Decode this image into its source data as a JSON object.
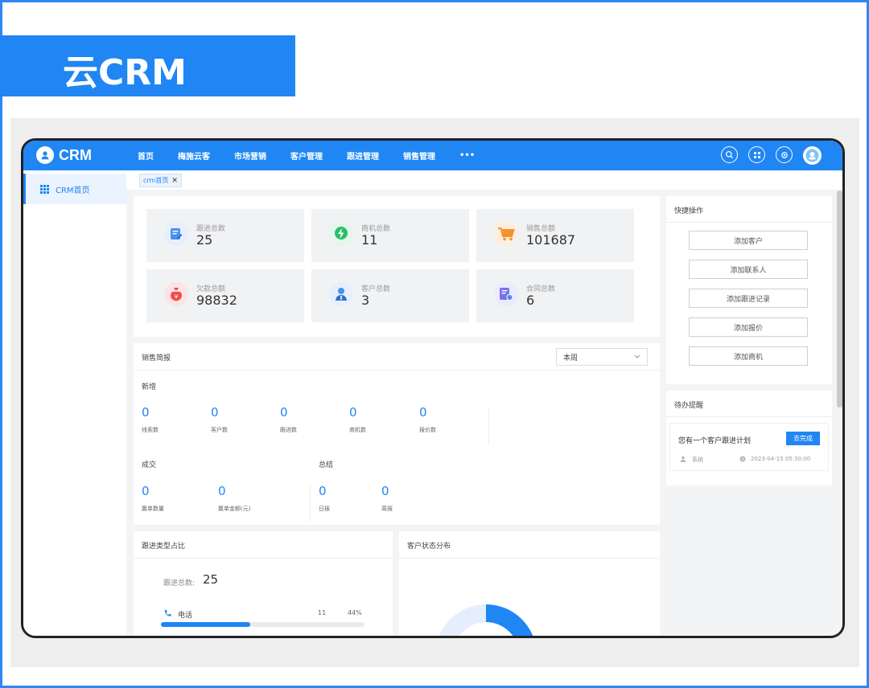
{
  "page": {
    "title": "云CRM"
  },
  "app": {
    "logo_text": "CRM",
    "nav": [
      "首页",
      "梅施云客",
      "市场营销",
      "客户管理",
      "跟进管理",
      "销售管理",
      "•••"
    ],
    "top_icons": [
      "search-icon",
      "grid-icon",
      "settings-icon",
      "user-avatar"
    ]
  },
  "sidebar": {
    "items": [
      {
        "label": "CRM首页",
        "icon": "grid-icon"
      }
    ]
  },
  "tabs": [
    {
      "label": "crm首页"
    }
  ],
  "stats": [
    {
      "label": "跟进总数",
      "value": "25",
      "icon": "edit-icon",
      "color": "#4a90f0"
    },
    {
      "label": "商机总数",
      "value": "11",
      "icon": "bolt-icon",
      "color": "#2bbf6a"
    },
    {
      "label": "销售总额",
      "value": "101687",
      "icon": "cart-icon",
      "color": "#f5922e"
    },
    {
      "label": "欠款总额",
      "value": "98832",
      "icon": "money-bag-icon",
      "color": "#ee5050"
    },
    {
      "label": "客户总数",
      "value": "3",
      "icon": "person-icon",
      "color": "#4a90f0"
    },
    {
      "label": "合同总数",
      "value": "6",
      "icon": "contract-icon",
      "color": "#7b6ff0"
    }
  ],
  "sales_report": {
    "title": "销售简报",
    "period": "本周",
    "new_label": "新增",
    "new_items": [
      {
        "value": "0",
        "label": "线索数"
      },
      {
        "value": "0",
        "label": "客户数"
      },
      {
        "value": "0",
        "label": "跟进数"
      },
      {
        "value": "0",
        "label": "商机数"
      },
      {
        "value": "0",
        "label": "报价数"
      }
    ],
    "deal_label": "成交",
    "deal_items": [
      {
        "value": "0",
        "label": "赢单数量"
      },
      {
        "value": "0",
        "label": "赢单金额(元)"
      }
    ],
    "summary_label": "总结",
    "summary_items": [
      {
        "value": "0",
        "label": "日报"
      },
      {
        "value": "0",
        "label": "周报"
      }
    ]
  },
  "quick_actions": {
    "title": "快捷操作",
    "buttons": [
      "添加客户",
      "添加联系人",
      "添加跟进记录",
      "添加报价",
      "添加商机"
    ]
  },
  "todo": {
    "title": "待办提醒",
    "item_text": "您有一个客户跟进计划",
    "done_button": "去完成",
    "source": "系统",
    "time": "2023-04-15 05:30:00"
  },
  "follow_ratio": {
    "title": "跟进类型占比",
    "total_label": "跟进总数:",
    "total_value": "25",
    "rows": [
      {
        "label": "电话",
        "count": "11",
        "percent": "44%",
        "fraction": 0.44
      }
    ]
  },
  "customer_status": {
    "title": "客户状态分布"
  }
}
